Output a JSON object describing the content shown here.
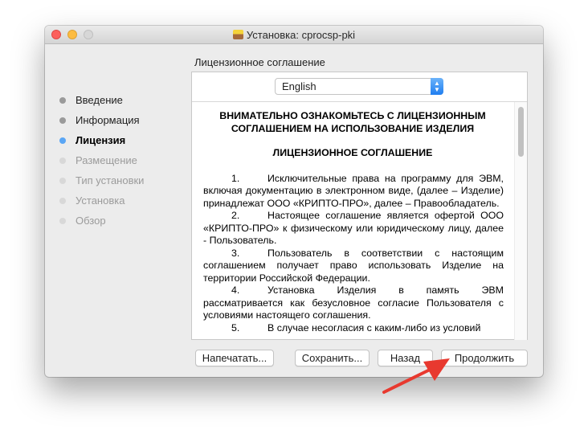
{
  "window": {
    "title": "Установка: cprocsp-pki",
    "icon": "package-icon"
  },
  "sidebar": {
    "steps": [
      {
        "label": "Введение",
        "state": "done"
      },
      {
        "label": "Информация",
        "state": "done"
      },
      {
        "label": "Лицензия",
        "state": "current"
      },
      {
        "label": "Размещение",
        "state": "future"
      },
      {
        "label": "Тип установки",
        "state": "future"
      },
      {
        "label": "Установка",
        "state": "future"
      },
      {
        "label": "Обзор",
        "state": "future"
      }
    ]
  },
  "main": {
    "section_title": "Лицензионное соглашение",
    "language_select": {
      "value": "English"
    },
    "document": {
      "heading1": "ВНИМАТЕЛЬНО ОЗНАКОМЬТЕСЬ С ЛИЦЕНЗИОННЫМ СОГЛАШЕНИЕМ НА ИСПОЛЬЗОВАНИЕ ИЗДЕЛИЯ",
      "heading2": "ЛИЦЕНЗИОННОЕ СОГЛАШЕНИЕ",
      "clauses": [
        {
          "num": "1.",
          "text": "Исключительные права на программу для ЭВМ, включая документацию в электронном виде, (далее – Изделие) принадлежат ООО «КРИПТО-ПРО», далее – Правообладатель."
        },
        {
          "num": "2.",
          "text": "Настоящее соглашение является офертой ООО «КРИПТО-ПРО» к физическому или юридическому лицу, далее - Пользователь."
        },
        {
          "num": "3.",
          "text": "Пользователь в соответствии с настоящим соглашением получает право использовать Изделие на территории Российской Федерации."
        },
        {
          "num": "4.",
          "text": "Установка Изделия в память ЭВМ рассматривается как безусловное согласие Пользователя с условиями настоящего соглашения."
        },
        {
          "num": "5.",
          "text": "В случае несогласия с каким-либо из условий"
        }
      ]
    }
  },
  "buttons": {
    "print": "Напечатать...",
    "save": "Сохранить...",
    "back": "Назад",
    "continue": "Продолжить"
  },
  "annotation": {
    "color": "#e8392f",
    "points_to": "continue"
  }
}
